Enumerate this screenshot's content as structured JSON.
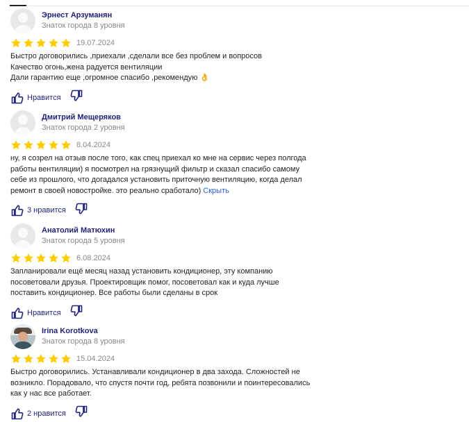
{
  "reviews": [
    {
      "author": "Эрнест Арзуманян",
      "level": "Знаток города 8 уровня",
      "stars": 5,
      "date": "19.07.2024",
      "lines": [
        "Быстро договорились ,приехали ,сделали все без проблем и вопросов",
        "Качество огонь,жена радуется вентиляции",
        "Дали гарантию еще ,огромное спасибо ,рекомендую 👌"
      ],
      "like_label": "Нравится",
      "has_photo": false
    },
    {
      "author": "Дмитрий Мещеряков",
      "level": "Знаток города 2 уровня",
      "stars": 5,
      "date": "8.04.2024",
      "lines": [
        "ну, я созрел на отзыв после того, как спец приехал ко мне на сервис через полгода",
        "работы вентиляции) я посмотрел на грязнущий фильтр и сказал спасибо самому",
        "себе из прошлого, что догадался установить приточную вентиляцию, когда делал",
        "ремонт в своей новостройке. это реально сработало)"
      ],
      "hide_label": "Скрыть",
      "like_label": "3 нравится",
      "has_photo": false
    },
    {
      "author": "Анатолий Матюхин",
      "level": "Знаток города 5 уровня",
      "stars": 5,
      "date": "6.08.2024",
      "lines": [
        "Запланировали ещё месяц назад установить кондиционер, эту компанию",
        "посоветовали друзья. Проектировщик помог, посоветовал как и куда лучше",
        "поставить кондиционер. Все работы были сделаны в срок"
      ],
      "like_label": "Нравится",
      "has_photo": false
    },
    {
      "author": "Irina Korotkova",
      "level": "Знаток города 8 уровня",
      "stars": 5,
      "date": "15.04.2024",
      "lines": [
        "Быстро договорились. Устанавливали кондиционер в два захода. Сложностей не",
        "возникло. Порадовало, что спустя почти год, ребята позвонили и поинтересовались",
        "как у нас все работает."
      ],
      "like_label": "2 нравится",
      "has_photo": true
    }
  ],
  "icons": {
    "star": "star-icon",
    "like": "thumbs-up-icon",
    "dislike": "thumbs-down-icon"
  },
  "colors": {
    "star": "#fc0",
    "accent": "#20237a",
    "link": "#2a5bd4",
    "muted": "#888888"
  }
}
